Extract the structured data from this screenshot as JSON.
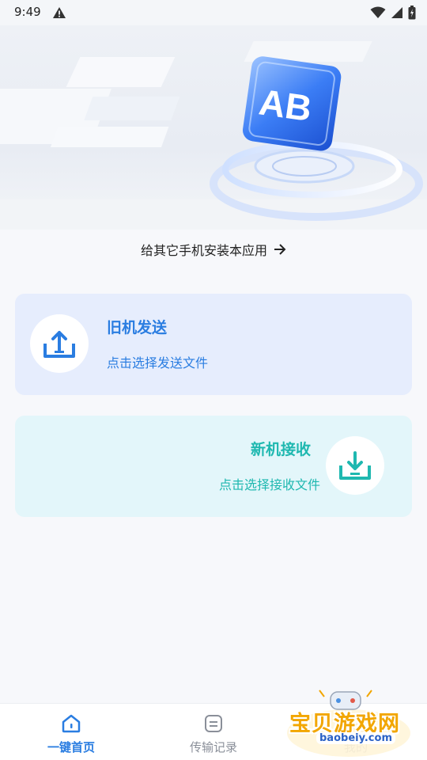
{
  "status_bar": {
    "time": "9:49"
  },
  "hero": {
    "link_text": "给其它手机安装本应用",
    "logo_text": "AB"
  },
  "cards": {
    "send": {
      "title": "旧机发送",
      "subtitle": "点击选择发送文件"
    },
    "receive": {
      "title": "新机接收",
      "subtitle": "点击选择接收文件"
    }
  },
  "tabs": [
    {
      "label": "一键首页",
      "active": true
    },
    {
      "label": "传输记录",
      "active": false
    },
    {
      "label": "我的",
      "active": false
    }
  ],
  "watermark": {
    "text": "宝贝游戏网",
    "url": "baobeiy.com"
  },
  "colors": {
    "primary": "#2a7de1",
    "teal": "#1fb8b0",
    "send_bg": "#e6edfd",
    "receive_bg": "#e3f6fa"
  }
}
